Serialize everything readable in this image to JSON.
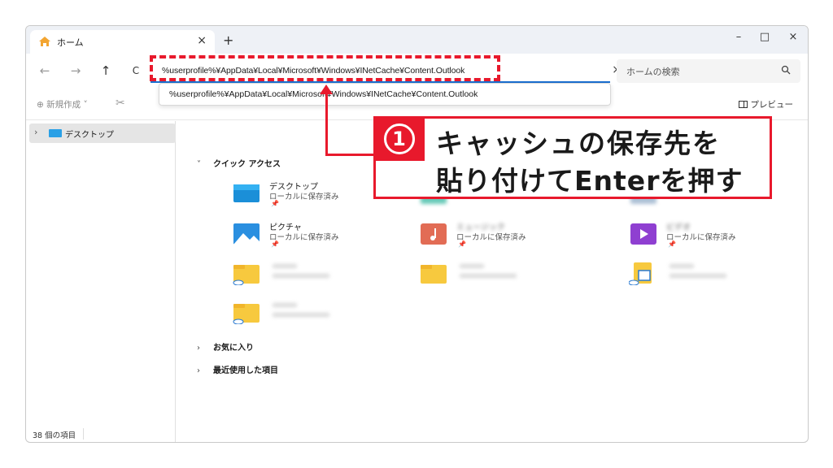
{
  "window": {
    "tab_title": "ホーム",
    "tab_close": "×",
    "new_tab": "+",
    "minimize": "–",
    "maximize": "□",
    "close": "×"
  },
  "nav": {
    "back": "←",
    "forward": "→",
    "up": "↑",
    "refresh": "C",
    "address_value": "%userprofile%¥AppData¥Local¥Microsoft¥Windows¥INetCache¥Content.Outlook",
    "address_clear": "×",
    "search_placeholder": "ホームの検索"
  },
  "dropdown": {
    "suggestion": "%userprofile%¥AppData¥Local¥Microsoft¥Windows¥INetCache¥Content.Outlook"
  },
  "toolbar": {
    "new_label": "⊕ 新規作成 ˅",
    "cut_icon": "✂",
    "preview_label": "プレビュー"
  },
  "sidebar": {
    "items": [
      {
        "label": "デスクトップ",
        "chevron": "›"
      }
    ]
  },
  "content": {
    "quick_access_label": "クイック アクセス",
    "favorites_label": "お気に入り",
    "recent_label": "最近使用した項目",
    "chevron_down": "˅",
    "chevron_right": "›",
    "items": [
      {
        "name": "デスクトップ",
        "sub": "ローカルに保存済み",
        "pin": "📌"
      },
      {
        "name": "ピクチャ",
        "sub": "ローカルに保存済み",
        "pin": "📌"
      },
      {
        "name": "ミュージック",
        "sub": "ローカルに保存済み",
        "pin": "📌"
      },
      {
        "name": "ビデオ",
        "sub": "ローカルに保存済み",
        "pin": "📌"
      }
    ]
  },
  "status": {
    "item_count": "38 個の項目"
  },
  "annotation": {
    "number": "1",
    "line1": "キャッシュの保存先を",
    "line2": "貼り付けてEnterを押す",
    "color": "#e8192c"
  }
}
